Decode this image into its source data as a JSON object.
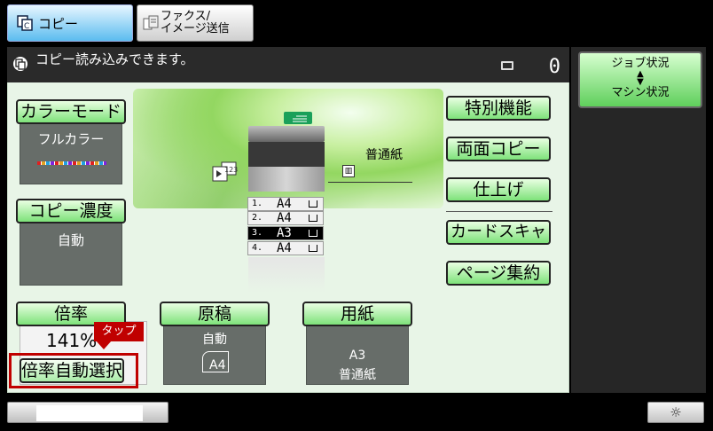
{
  "tabs": {
    "copy": "コピー",
    "fax_line1": "ファクス/",
    "fax_line2": "イメージ送信"
  },
  "status": {
    "message": "コピー読み込みできます。",
    "count": "0"
  },
  "color_mode": {
    "label": "カラーモード",
    "value": "フルカラー"
  },
  "density": {
    "label": "コピー濃度",
    "value": "自動"
  },
  "ratio": {
    "label": "倍率",
    "value": "141%",
    "auto_select": "倍率自動選択"
  },
  "original": {
    "label": "原稿",
    "value": "自動",
    "size": "A4"
  },
  "paper": {
    "label": "用紙",
    "size": "A3",
    "type": "普通紙"
  },
  "machine": {
    "output_paper": "普通紙",
    "trays": [
      {
        "num": "1.",
        "size": "A4",
        "selected": false
      },
      {
        "num": "2.",
        "size": "A4",
        "selected": false
      },
      {
        "num": "3.",
        "size": "A3",
        "selected": true
      },
      {
        "num": "4.",
        "size": "A4",
        "selected": false
      }
    ]
  },
  "right_buttons": {
    "special": "特別機能",
    "duplex": "両面コピー",
    "finish": "仕上げ",
    "card_scan": "カードスキャ",
    "page_combine": "ページ集約"
  },
  "job_status": {
    "line1": "ジョブ状況",
    "line2": "マシン状況"
  },
  "tap_hint": "タップ",
  "colors": {
    "tap_red": "#c00000",
    "button_green": "#7ee27a",
    "tab_blue": "#5bbcef"
  }
}
